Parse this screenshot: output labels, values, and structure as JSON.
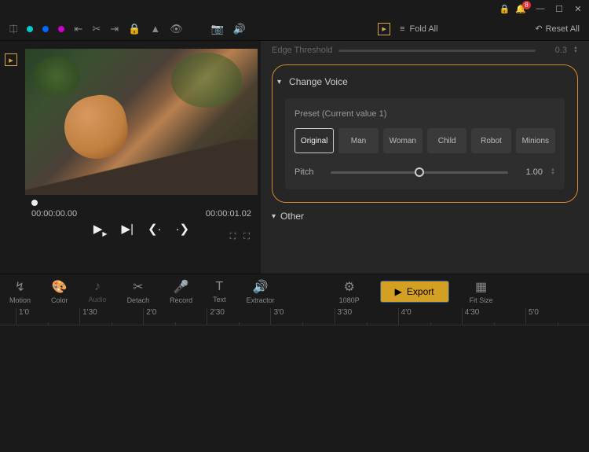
{
  "titlebar": {
    "notification_count": "8"
  },
  "toolbar": {
    "fold_all": "Fold All",
    "reset_all": "Reset All"
  },
  "preview": {
    "current_time": "00:00:00.00",
    "total_time": "00:00:01.02"
  },
  "inspector": {
    "edge_threshold_label": "Edge Threshold",
    "edge_threshold_value": "0.3",
    "change_voice": {
      "title": "Change Voice",
      "preset_label": "Preset  (Current value 1)",
      "presets": [
        "Original",
        "Man",
        "Woman",
        "Child",
        "Robot",
        "Minions"
      ],
      "pitch_label": "Pitch",
      "pitch_value": "1.00"
    },
    "other_title": "Other"
  },
  "actionbar": {
    "motion": "Motion",
    "color": "Color",
    "audio": "Audio",
    "detach": "Detach",
    "record": "Record",
    "text": "Text",
    "extractor": "Extractor",
    "resolution": "1080P",
    "export": "Export",
    "fit_size": "Fit Size"
  },
  "timeline": {
    "ticks": [
      "1'0",
      "1'30",
      "2'0",
      "2'30",
      "3'0",
      "3'30",
      "4'0",
      "4'30",
      "5'0"
    ]
  }
}
